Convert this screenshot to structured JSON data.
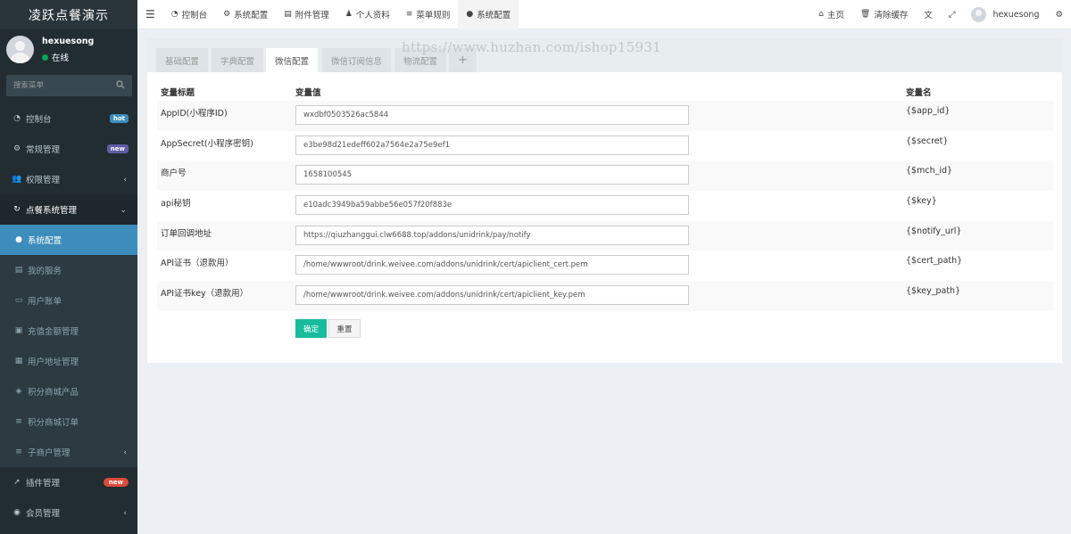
{
  "brand": "凌跃点餐演示",
  "user": {
    "name": "hexuesong",
    "status": "在线"
  },
  "search": {
    "placeholder": "搜索菜单"
  },
  "menu": {
    "dashboard": {
      "label": "控制台",
      "badge": "hot"
    },
    "general": {
      "label": "常规管理",
      "badge": "new"
    },
    "auth": {
      "label": "权限管理"
    },
    "dining": {
      "label": "点餐系统管理"
    },
    "sub": [
      {
        "label": "系统配置"
      },
      {
        "label": "我的服务"
      },
      {
        "label": "用户账单"
      },
      {
        "label": "充值金额管理"
      },
      {
        "label": "用户地址管理"
      },
      {
        "label": "积分商城产品"
      },
      {
        "label": "积分商城订单"
      },
      {
        "label": "子商户管理"
      }
    ],
    "addon": {
      "label": "插件管理",
      "badge": "new"
    },
    "member": {
      "label": "会员管理"
    }
  },
  "header": {
    "nav": [
      "控制台",
      "系统配置",
      "附件管理",
      "个人资料",
      "菜单规则",
      "系统配置"
    ],
    "home": "主页",
    "clear_cache": "清除缓存",
    "username": "hexuesong"
  },
  "tabs": [
    "基础配置",
    "字典配置",
    "微信配置",
    "微信订阅信息",
    "物流配置",
    "+"
  ],
  "watermark": "https://www.huzhan.com/ishop15931",
  "table": {
    "headers": [
      "变量标题",
      "变量值",
      "变量名"
    ],
    "rows": [
      {
        "title": "AppID(小程序ID)",
        "value": "wxdbf0503526ac5844",
        "name": "{$app_id}"
      },
      {
        "title": "AppSecret(小程序密钥)",
        "value": "e3be98d21edeff602a7564e2a75e9ef1",
        "name": "{$secret}"
      },
      {
        "title": "商户号",
        "value": "1658100545",
        "name": "{$mch_id}"
      },
      {
        "title": "api秘钥",
        "value": "e10adc3949ba59abbe56e057f20f883e",
        "name": "{$key}"
      },
      {
        "title": "订单回调地址",
        "value": "https://qiuzhanggui.clw6688.top/addons/unidrink/pay/notify",
        "name": "{$notify_url}"
      },
      {
        "title": "API证书（退款用）",
        "value": "/home/wwwroot/drink.weivee.com/addons/unidrink/cert/apiclient_cert.pem",
        "name": "{$cert_path}"
      },
      {
        "title": "API证书key（退款用）",
        "value": "/home/wwwroot/drink.weivee.com/addons/unidrink/cert/apiclient_key.pem",
        "name": "{$key_path}"
      }
    ]
  },
  "buttons": {
    "submit": "确定",
    "reset": "重置"
  }
}
